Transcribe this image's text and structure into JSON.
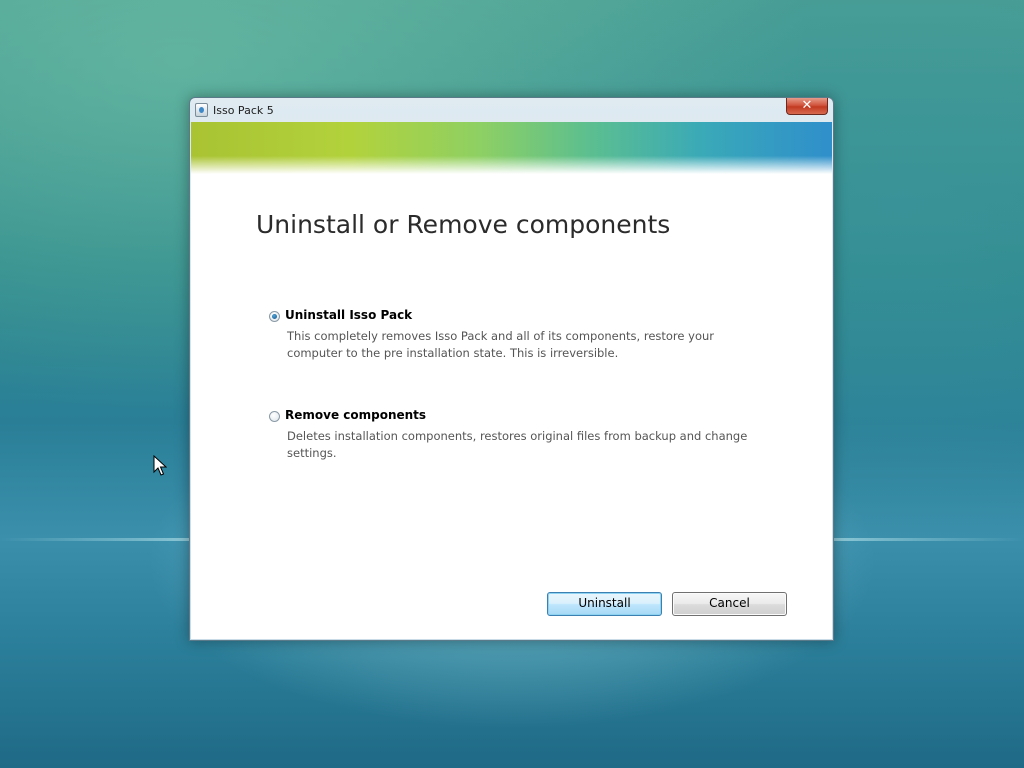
{
  "window": {
    "title": "Isso Pack 5",
    "close_label": "✕"
  },
  "dialog": {
    "heading": "Uninstall or Remove components",
    "options": [
      {
        "label": "Uninstall Isso Pack",
        "description": "This completely removes Isso Pack and all of its components, restore your computer to the pre installation state. This is irreversible.",
        "selected": true
      },
      {
        "label": "Remove components",
        "description": "Deletes installation components, restores original files from backup and change settings.",
        "selected": false
      }
    ],
    "buttons": {
      "uninstall": "Uninstall",
      "cancel": "Cancel"
    }
  },
  "colors": {
    "accent": "#3c7fb1",
    "close_button": "#c23a22"
  },
  "icons": {
    "app": "installer-icon",
    "close": "close-icon",
    "cursor": "mouse-pointer-icon"
  }
}
